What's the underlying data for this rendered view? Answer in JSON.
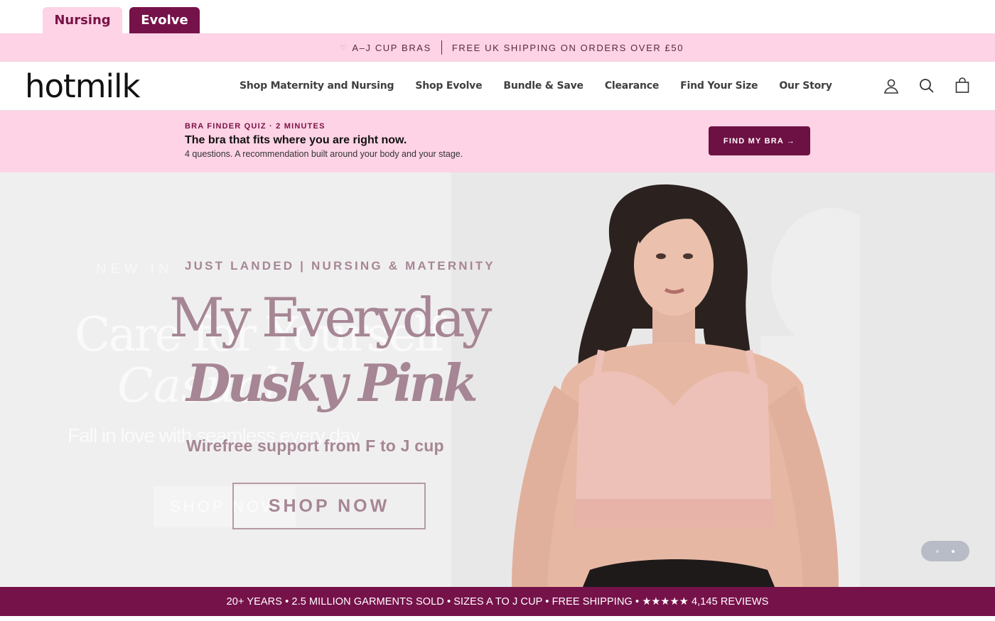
{
  "brand_tabs": [
    {
      "label": "Nursing",
      "active": true
    },
    {
      "label": "Evolve",
      "active": false
    }
  ],
  "announcement": {
    "left_text": "A–J CUP BRAS",
    "right_text": "FREE UK SHIPPING ON ORDERS OVER £50"
  },
  "header": {
    "logo": "hotmilk",
    "nav": [
      "Shop Maternity and Nursing",
      "Shop Evolve",
      "Bundle & Save",
      "Clearance",
      "Find Your Size",
      "Our Story"
    ],
    "icons": [
      "account-icon",
      "search-icon",
      "bag-icon"
    ]
  },
  "quiz": {
    "eyebrow": "BRA FINDER QUIZ · 2 MINUTES",
    "headline": "The bra that fits where you are right now.",
    "sub": "4 questions. A recommendation built around your body and your stage.",
    "cta": "FIND MY BRA →"
  },
  "hero": {
    "eyebrow": "JUST LANDED | NURSING & MATERNITY",
    "title_line1": "My Everyday",
    "title_line2": "Dusky Pink",
    "subtitle": "Wirefree support from F to J cup",
    "cta": "SHOP NOW",
    "ghost": {
      "eyebrow": "NEW IN",
      "title_line1": "Care for Yourself",
      "title_line2": "Casual",
      "subtitle": "Fall in love with seamless every day",
      "cta": "SHOP NOW"
    },
    "slides": 2,
    "active_slide": 2
  },
  "trust_bar": "20+ YEARS • 2.5 MILLION GARMENTS SOLD • SIZES A TO J CUP • FREE SHIPPING • ★★★★★ 4,145 REVIEWS",
  "colors": {
    "plum": "#76124a",
    "pink": "#fdd3e5",
    "mauve_text": "#a68694"
  }
}
